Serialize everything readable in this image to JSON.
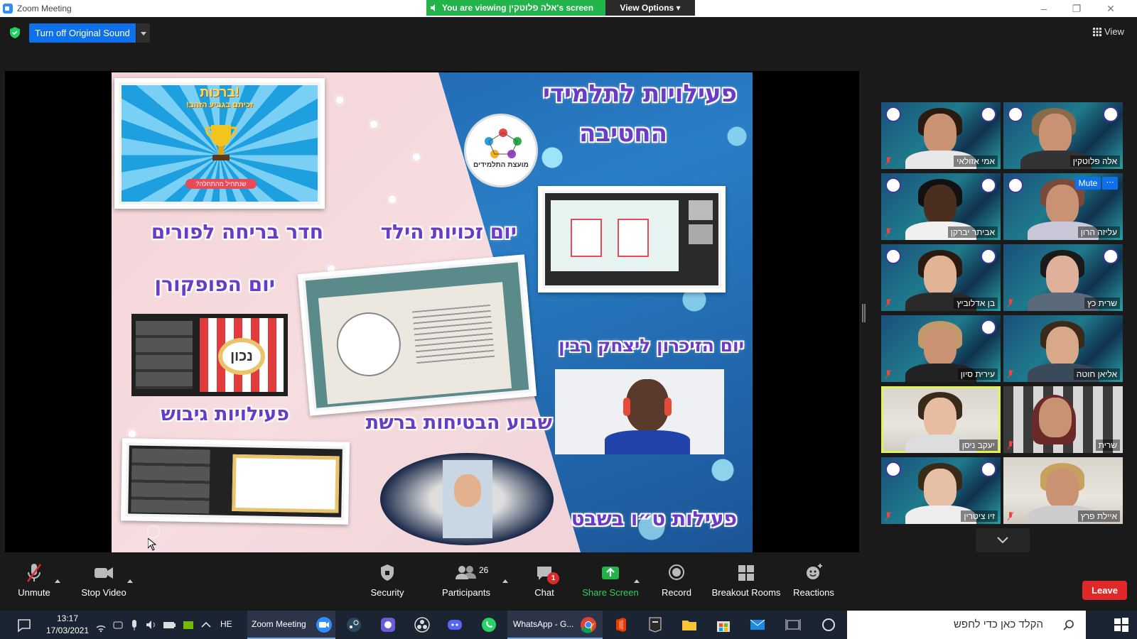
{
  "window": {
    "title": "Zoom Meeting",
    "viewing_banner": "You are viewing אלה פלוטקין's screen",
    "view_options": "View Options ▾"
  },
  "meeting_top": {
    "original_sound_button": "Turn off Original Sound",
    "view_button": "View"
  },
  "slide": {
    "title_line1": "פעילויות לתלמידי",
    "title_line2": "החטיבה",
    "logo_text": "מועצת התלמידים",
    "labels": {
      "escape_room": "חדר בריחה לפורים",
      "child_rights": "יום זכויות הילד",
      "popcorn_day": "יום הפופקורן",
      "rabin_memorial": "יום הזיכרון ליצחק רבין",
      "bonding": "פעילויות גיבוש",
      "online_safety": "שבוע הבטיחות ברשת",
      "tu_bishvat": "פעילות ט״ו בשבט"
    },
    "screen1_title": "ברכות!",
    "screen1_subtitle": "זכיתם בגביע הזהב!",
    "screen1_button": "שנתחיל מהתחלה?",
    "popcorn_word": "נכון"
  },
  "gallery": {
    "participants": [
      {
        "name": "אמי אזולאי"
      },
      {
        "name": "אלה פלוטקין"
      },
      {
        "name": "אביתר יברקן"
      },
      {
        "name": "עליזה הרון"
      },
      {
        "name": "בן אדלוביץ"
      },
      {
        "name": "שרית כץ"
      },
      {
        "name": "עירית סיון"
      },
      {
        "name": "אליאן חוטה"
      },
      {
        "name": "יעקב ניסן"
      },
      {
        "name": "שרית"
      },
      {
        "name": "זיו ציטרין"
      },
      {
        "name": "איילת פרץ"
      }
    ],
    "mute_label": "Mute",
    "more_label": "⋯"
  },
  "toolbar": {
    "unmute": "Unmute",
    "stop_video": "Stop Video",
    "security": "Security",
    "participants": "Participants",
    "participants_count": "26",
    "chat": "Chat",
    "chat_badge": "1",
    "share_screen": "Share Screen",
    "record": "Record",
    "breakout_rooms": "Breakout Rooms",
    "reactions": "Reactions",
    "leave": "Leave"
  },
  "taskbar": {
    "time": "13:17",
    "date": "17/03/2021",
    "lang": "HE",
    "zoom_task": "Zoom Meeting",
    "whatsapp_task": "WhatsApp - G...",
    "search_placeholder": "הקלד כאן כדי לחפש"
  },
  "colors": {
    "zoom_blue": "#0e71eb",
    "leave_red": "#e02828",
    "share_green": "#22b34a",
    "active_speaker": "#dff25a"
  }
}
